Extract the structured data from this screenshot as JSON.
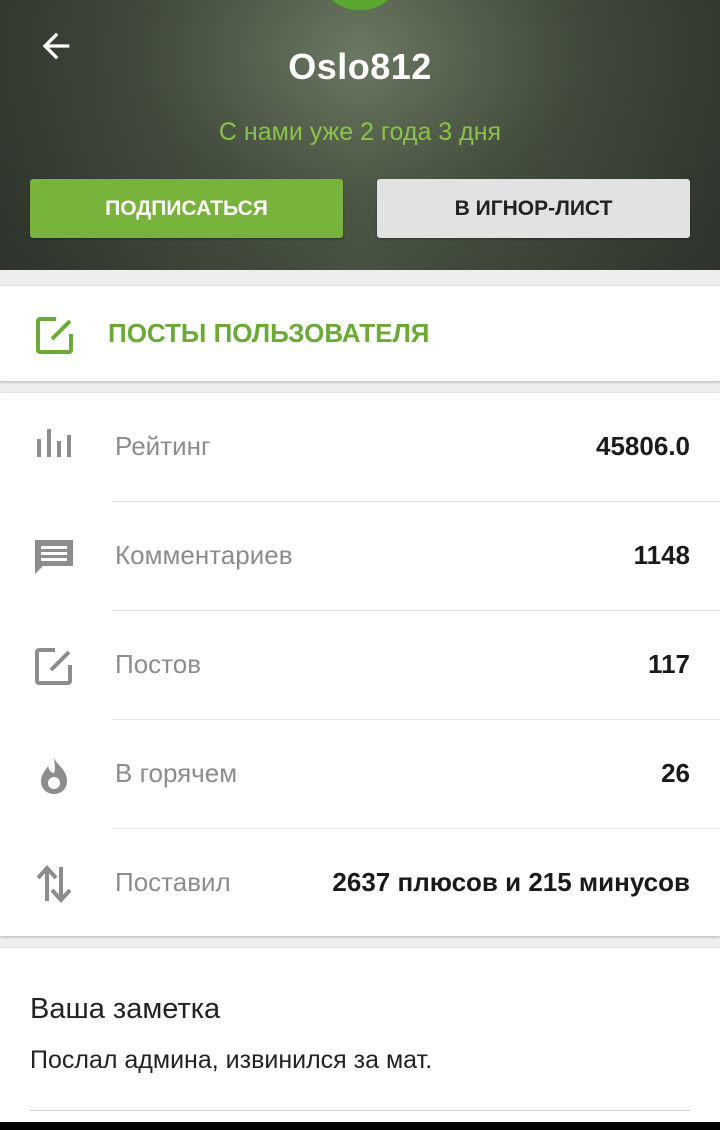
{
  "profile": {
    "username": "Oslo812",
    "member_since": "С нами уже 2 года 3 дня",
    "subscribe_label": "ПОДПИСАТЬСЯ",
    "ignore_label": "В ИГНОР-ЛИСТ",
    "accent_color": "#78b43c"
  },
  "posts_link": {
    "label": "ПОСТЫ ПОЛЬЗОВАТЕЛЯ",
    "icon": "edit-icon"
  },
  "stats": [
    {
      "icon": "bar-chart-icon",
      "label": "Рейтинг",
      "value": "45806.0"
    },
    {
      "icon": "comment-icon",
      "label": "Комментариев",
      "value": "1148"
    },
    {
      "icon": "edit-icon",
      "label": "Постов",
      "value": "117"
    },
    {
      "icon": "flame-icon",
      "label": "В горячем",
      "value": "26"
    },
    {
      "icon": "swap-vertical-icon",
      "label": "Поставил",
      "value": "2637 плюсов и 215 минусов"
    }
  ],
  "note": {
    "title": "Ваша заметка",
    "text": "Послал админа, извинился за мат."
  }
}
